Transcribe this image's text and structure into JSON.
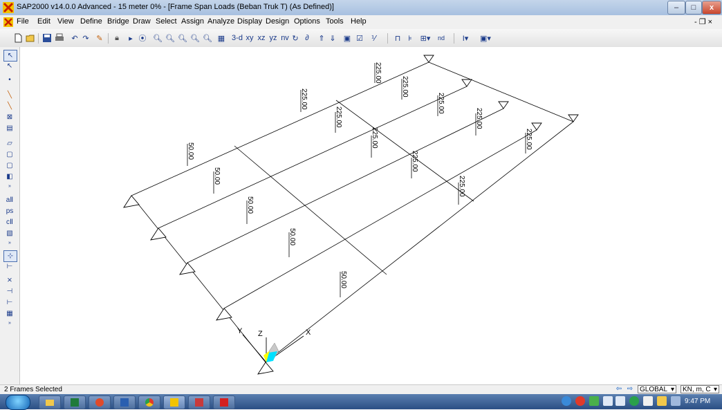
{
  "window": {
    "title": "SAP2000 v14.0.0 Advanced  - 15 meter 0% - [Frame Span Loads (Beban Truk T) (As Defined)]",
    "minimize": "–",
    "maximize": "□",
    "close": "x",
    "mdi_restore": "- &#8739; ×"
  },
  "menu": {
    "items": [
      "File",
      "Edit",
      "View",
      "Define",
      "Bridge",
      "Draw",
      "Select",
      "Assign",
      "Analyze",
      "Display",
      "Design",
      "Options",
      "Tools",
      "Help"
    ],
    "mdi_controls": "- ❐ ×"
  },
  "toolbar": {
    "view_3d": "3-d",
    "view_xy": "xy",
    "view_xz": "xz",
    "view_yz": "yz",
    "view_nv": "nv",
    "nd": "nd"
  },
  "canvas": {
    "loads_225": [
      "225.00",
      "225.00",
      "225.00",
      "225.00",
      "225.00",
      "225.00",
      "225.00",
      "225.00",
      "225.00",
      "225.00"
    ],
    "loads_50": [
      "50.00",
      "50.00",
      "50.00",
      "50.00",
      "50.00"
    ],
    "axis_labels": {
      "x": "X",
      "y": "Y",
      "z": "Z"
    }
  },
  "status": {
    "text": "2 Frames Selected",
    "coord_system": "GLOBAL",
    "units": "KN, m, C"
  },
  "taskbar": {
    "clock": "9:47 PM"
  },
  "colors": {
    "title_bar": "#b4c9e6",
    "close_button": "#c8452c",
    "taskbar": "#2b4f84",
    "axis_highlight_yellow": "#ffff00",
    "axis_highlight_cyan": "#00e0ff"
  }
}
